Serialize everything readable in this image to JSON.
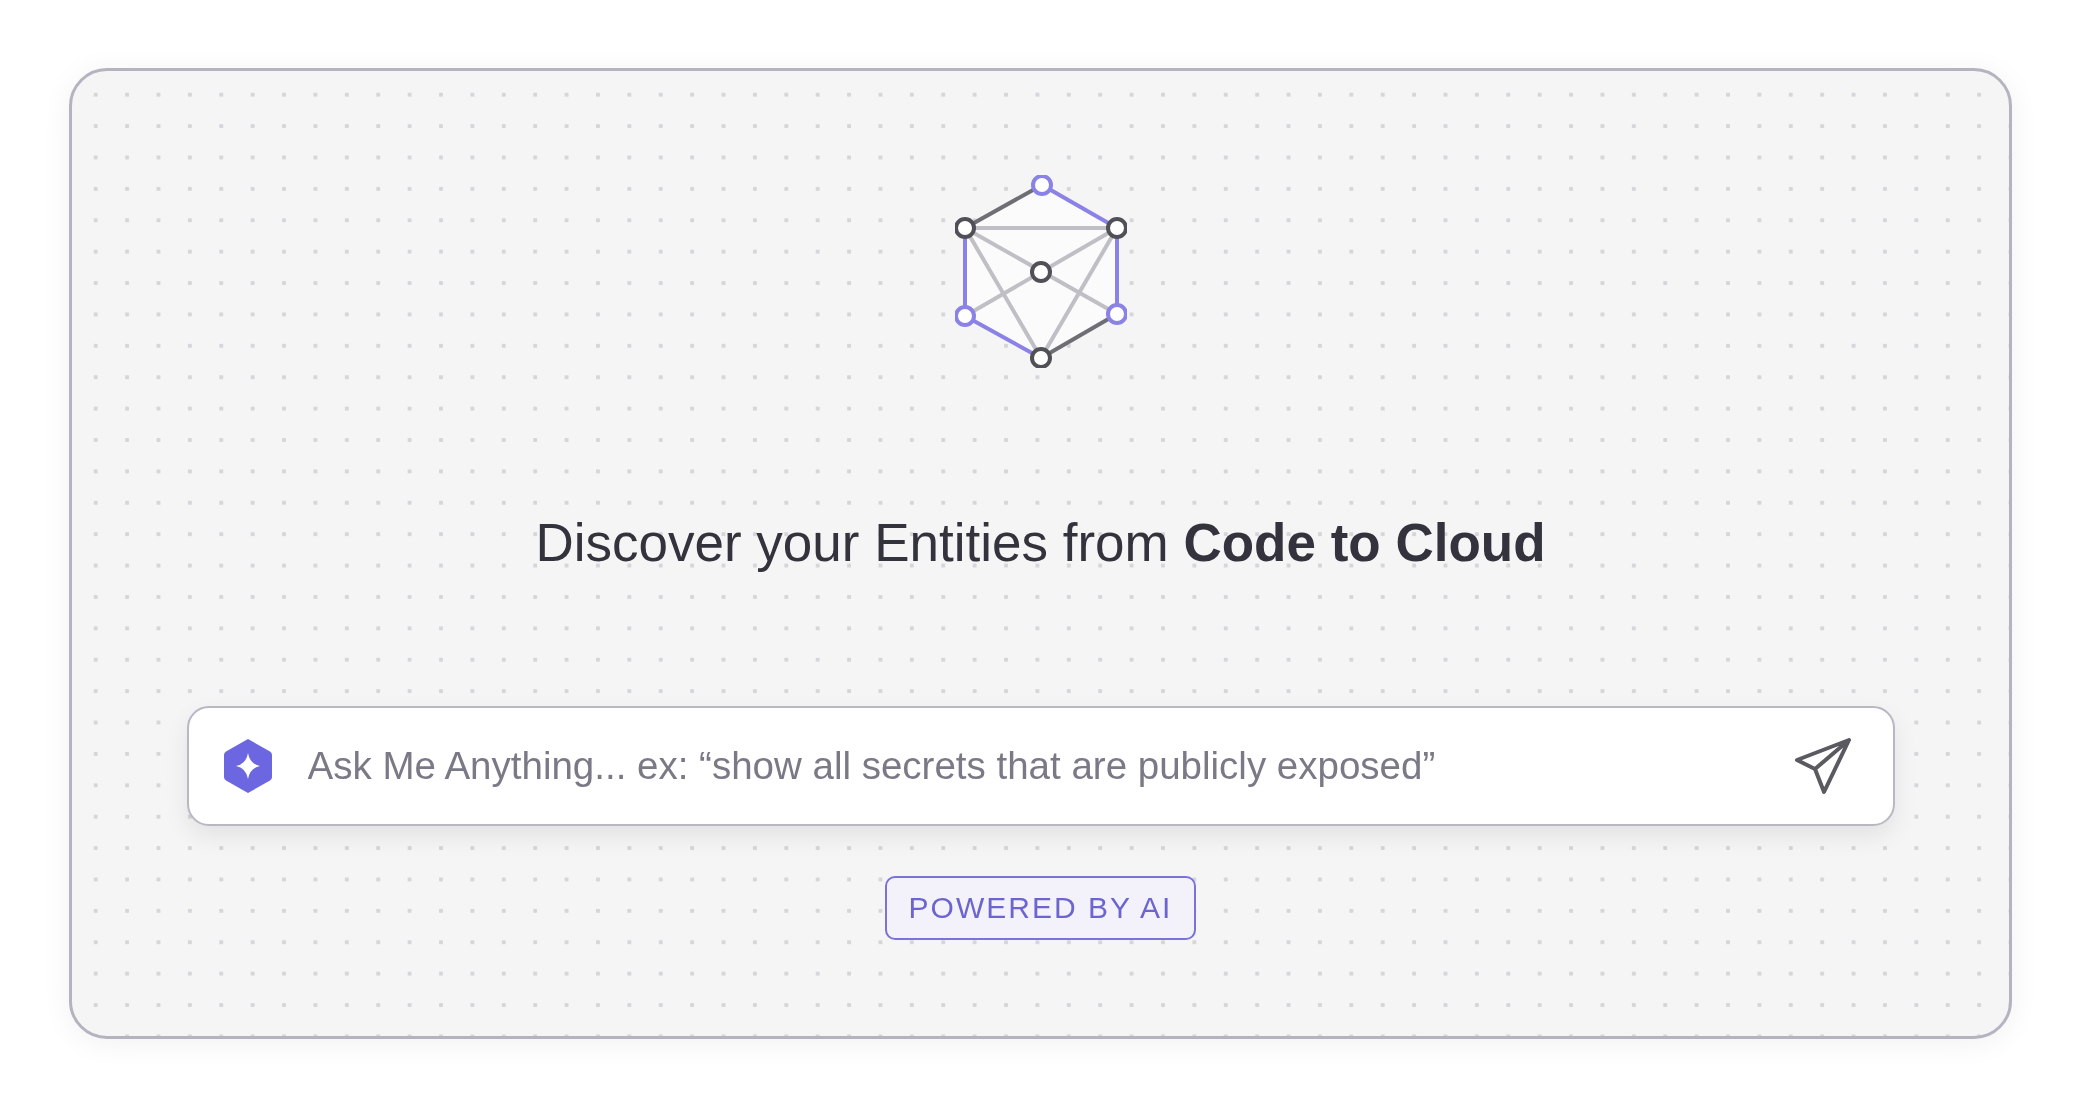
{
  "heading": "Discover your Entities from **Code to Cloud**",
  "ask_field": {
    "placeholder": "Ask Me Anything... ex: “show all secrets that are publicly exposed”"
  },
  "badge": "POWERED BY AI"
}
